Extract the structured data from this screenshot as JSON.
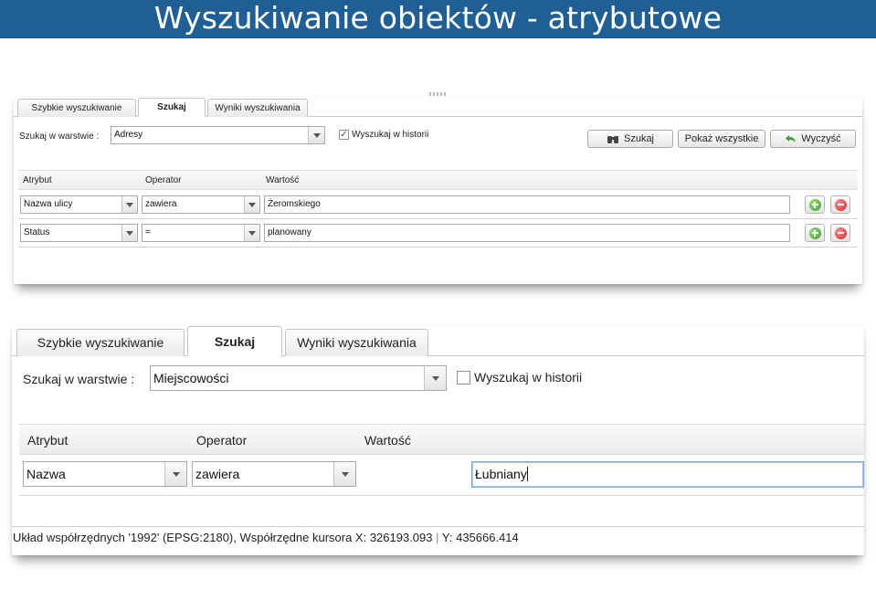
{
  "slide": {
    "title": "Wyszukiwanie obiektów - atrybutowe",
    "colors": {
      "banner": "#1f5f96",
      "title_text": "#ffffff"
    }
  },
  "panel_small": {
    "tabs": [
      {
        "label": "Szybkie wyszukiwanie",
        "active": false
      },
      {
        "label": "Szukaj",
        "active": true
      },
      {
        "label": "Wyniki wyszukiwania",
        "active": false
      }
    ],
    "layer_label": "Szukaj w warstwie :",
    "layer_value": "Adresy",
    "history_label": "Wyszukaj w historii",
    "history_checked": true,
    "buttons": {
      "search": "Szukaj",
      "show_all": "Pokaż wszystkie",
      "clear": "Wyczyść"
    },
    "columns": {
      "attribute": "Atrybut",
      "operator": "Operator",
      "value": "Wartość"
    },
    "rows": [
      {
        "attribute": "Nazwa ulicy",
        "operator": "zawiera",
        "value": "Żeromskiego"
      },
      {
        "attribute": "Status",
        "operator": "=",
        "value": "planowany"
      }
    ]
  },
  "panel_large": {
    "tabs": [
      {
        "label": "Szybkie wyszukiwanie",
        "active": false
      },
      {
        "label": "Szukaj",
        "active": true
      },
      {
        "label": "Wyniki wyszukiwania",
        "active": false
      }
    ],
    "layer_label": "Szukaj w warstwie :",
    "layer_value": "Miejscowości",
    "history_label": "Wyszukaj w historii",
    "history_checked": false,
    "columns": {
      "attribute": "Atrybut",
      "operator": "Operator",
      "value": "Wartość"
    },
    "rows": [
      {
        "attribute": "Nazwa",
        "operator": "zawiera",
        "value": "Łubniany"
      }
    ],
    "status": {
      "crs_text": "Układ współrzędnych '1992' (EPSG:2180), Współrzędne kursora X: 326193.093",
      "separator": "|",
      "y_text": "Y: 435666.414"
    }
  }
}
